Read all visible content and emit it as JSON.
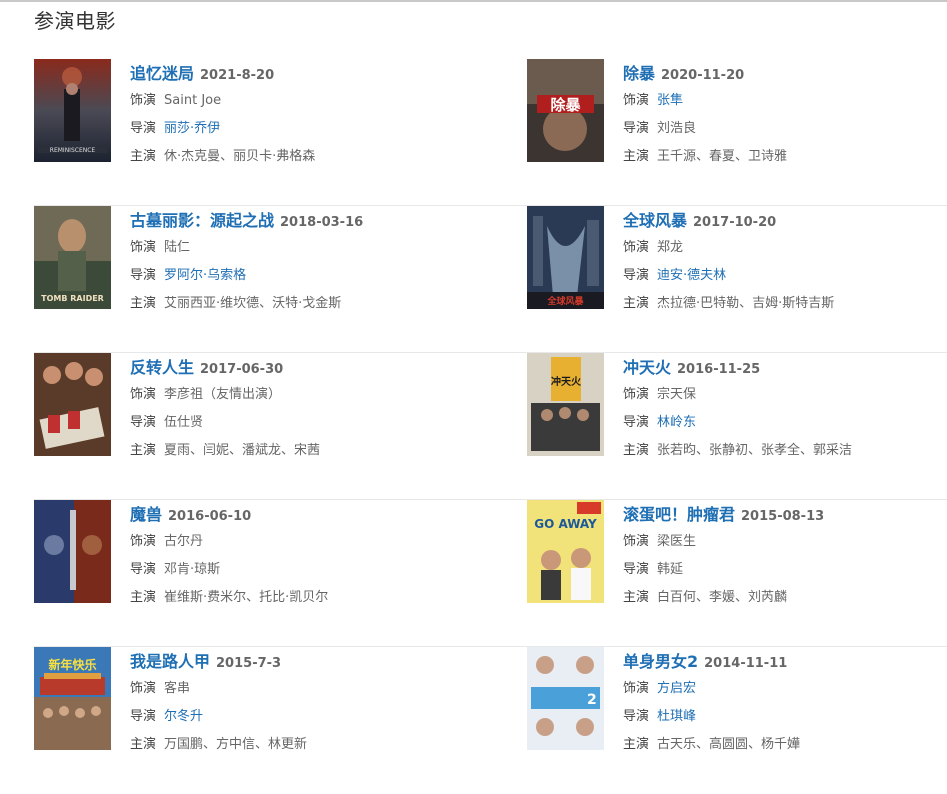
{
  "section": {
    "title": "参演电影"
  },
  "labels": {
    "role": "饰演",
    "director": "导演",
    "cast": "主演"
  },
  "films": [
    {
      "title": "追忆迷局",
      "date": "2021-8-20",
      "role": "Saint Joe",
      "director": "丽莎·乔伊",
      "director_link": true,
      "cast": "休·杰克曼、丽贝卡·弗格森",
      "poster": "reminiscence-poster",
      "poster_text": "REMINISCENCE"
    },
    {
      "title": "除暴",
      "date": "2020-11-20",
      "role": "张隼",
      "role_link": true,
      "director": "刘浩良",
      "director_link": false,
      "cast": "王千源、春夏、卫诗雅",
      "poster": "chubao-poster",
      "poster_text": "除暴"
    },
    {
      "title": "古墓丽影：源起之战",
      "date": "2018-03-16",
      "role": "陆仁",
      "director": "罗阿尔·乌索格",
      "director_link": true,
      "cast": "艾丽西亚·维坎德、沃特·戈金斯",
      "poster": "tomb-raider-poster",
      "poster_text": "TOMB RAIDER"
    },
    {
      "title": "全球风暴",
      "date": "2017-10-20",
      "role": "郑龙",
      "director": "迪安·德夫林",
      "director_link": true,
      "cast": "杰拉德·巴特勒、吉姆·斯特吉斯",
      "poster": "geostorm-poster",
      "poster_text": "全球风暴"
    },
    {
      "title": "反转人生",
      "date": "2017-06-30",
      "role": "李彦祖（友情出演）",
      "director": "伍仕贤",
      "director_link": false,
      "cast": "夏雨、闫妮、潘斌龙、宋茜",
      "poster": "fanzhuan-poster",
      "poster_text": ""
    },
    {
      "title": "冲天火",
      "date": "2016-11-25",
      "role": "宗天保",
      "director": "林岭东",
      "director_link": true,
      "cast": "张若昀、张静初、张孝全、郭采洁",
      "poster": "chongtianhuo-poster",
      "poster_text": "冲天火"
    },
    {
      "title": "魔兽",
      "date": "2016-06-10",
      "role": "古尔丹",
      "director": "邓肯·琼斯",
      "director_link": false,
      "cast": "崔维斯·费米尔、托比·凯贝尔",
      "poster": "warcraft-poster",
      "poster_text": ""
    },
    {
      "title": "滚蛋吧！肿瘤君",
      "date": "2015-08-13",
      "role": "梁医生",
      "director": "韩延",
      "director_link": false,
      "cast": "白百何、李媛、刘芮麟",
      "poster": "go-away-poster",
      "poster_text": "GO AWAY"
    },
    {
      "title": "我是路人甲",
      "date": "2015-7-3",
      "role": "客串",
      "director": "尔冬升",
      "director_link": true,
      "cast": "万国鹏、方中信、林更新",
      "poster": "lurenjia-poster",
      "poster_text": "新年快乐"
    },
    {
      "title": "单身男女2",
      "date": "2014-11-11",
      "role": "方启宏",
      "role_link": true,
      "director": "杜琪峰",
      "director_link": true,
      "cast": "古天乐、高圆圆、杨千嬅",
      "poster": "danshen-poster",
      "poster_text": ""
    }
  ]
}
